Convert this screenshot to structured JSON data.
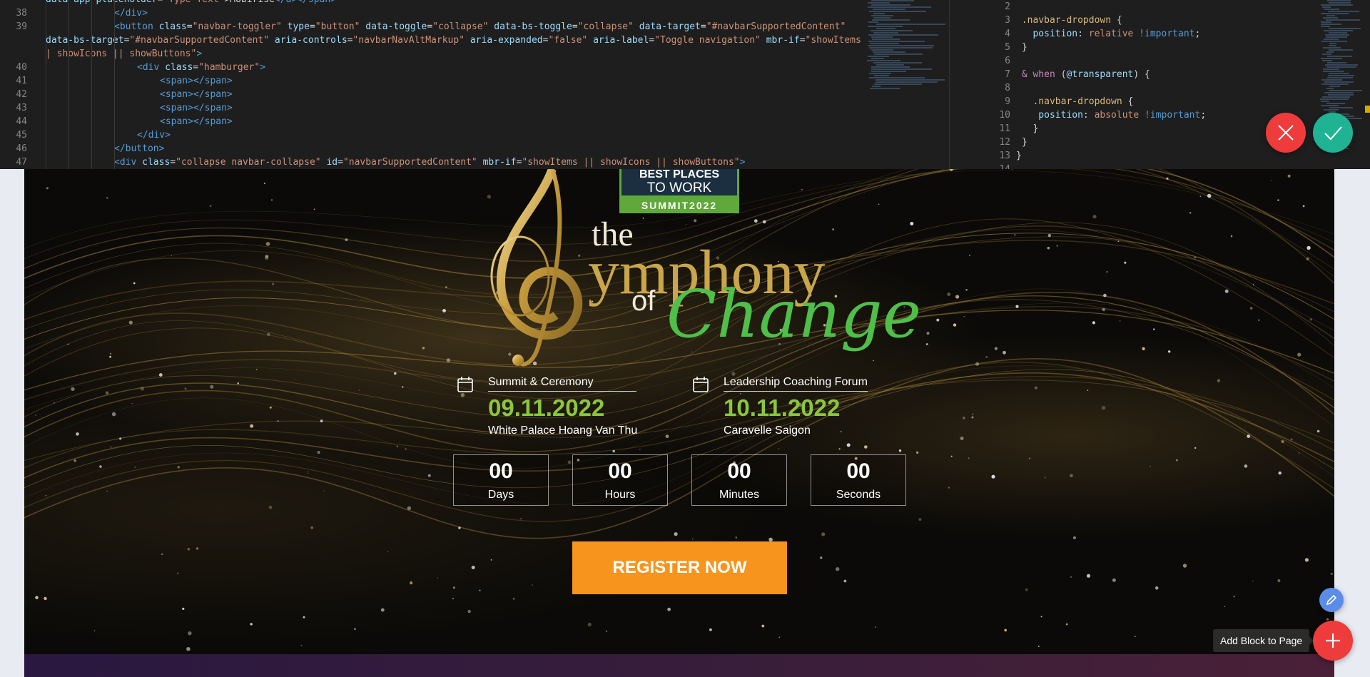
{
  "editor": {
    "html_lines": [
      {
        "no": "",
        "indent": 0,
        "parts": [
          [
            "attr",
            "data-app-placeholder"
          ],
          [
            "txt",
            "="
          ],
          [
            "str",
            "\"Type Text\""
          ],
          [
            "txt",
            ">"
          ],
          [
            "txt",
            "Mobirise"
          ],
          [
            "tag",
            "</a></span>"
          ]
        ]
      },
      {
        "no": "38",
        "indent": 3,
        "parts": [
          [
            "tag",
            "</div>"
          ]
        ]
      },
      {
        "no": "39",
        "indent": 3,
        "parts": [
          [
            "tag",
            "<button "
          ],
          [
            "attr",
            "class"
          ],
          [
            "txt",
            "="
          ],
          [
            "str",
            "\"navbar-toggler\" "
          ],
          [
            "attr",
            "type"
          ],
          [
            "txt",
            "="
          ],
          [
            "str",
            "\"button\" "
          ],
          [
            "attr",
            "data-toggle"
          ],
          [
            "txt",
            "="
          ],
          [
            "str",
            "\"collapse\" "
          ],
          [
            "attr",
            "data-bs-toggle"
          ],
          [
            "txt",
            "="
          ],
          [
            "str",
            "\"collapse\" "
          ],
          [
            "attr",
            "data-target"
          ],
          [
            "txt",
            "="
          ],
          [
            "str",
            "\"#navbarSupportedContent\""
          ]
        ]
      },
      {
        "no": "",
        "indent": 0,
        "parts": [
          [
            "attr",
            "data-bs-target"
          ],
          [
            "txt",
            "="
          ],
          [
            "str",
            "\"#navbarSupportedContent\" "
          ],
          [
            "attr",
            "aria-controls"
          ],
          [
            "txt",
            "="
          ],
          [
            "str",
            "\"navbarNavAltMarkup\" "
          ],
          [
            "attr",
            "aria-expanded"
          ],
          [
            "txt",
            "="
          ],
          [
            "str",
            "\"false\" "
          ],
          [
            "attr",
            "aria-label"
          ],
          [
            "txt",
            "="
          ],
          [
            "str",
            "\"Toggle navigation\" "
          ],
          [
            "attr",
            "mbr-if"
          ],
          [
            "txt",
            "="
          ],
          [
            "str",
            "\"showItems |"
          ]
        ]
      },
      {
        "no": "",
        "indent": 0,
        "parts": [
          [
            "str",
            "| showIcons || showButtons\""
          ],
          [
            "tag",
            ">"
          ]
        ]
      },
      {
        "no": "40",
        "indent": 4,
        "parts": [
          [
            "tag",
            "<div "
          ],
          [
            "attr",
            "class"
          ],
          [
            "txt",
            "="
          ],
          [
            "str",
            "\"hamburger\""
          ],
          [
            "tag",
            ">"
          ]
        ]
      },
      {
        "no": "41",
        "indent": 5,
        "parts": [
          [
            "tag",
            "<span></span>"
          ]
        ]
      },
      {
        "no": "42",
        "indent": 5,
        "parts": [
          [
            "tag",
            "<span></span>"
          ]
        ]
      },
      {
        "no": "43",
        "indent": 5,
        "parts": [
          [
            "tag",
            "<span></span>"
          ]
        ]
      },
      {
        "no": "44",
        "indent": 5,
        "parts": [
          [
            "tag",
            "<span></span>"
          ]
        ]
      },
      {
        "no": "45",
        "indent": 4,
        "parts": [
          [
            "tag",
            "</div>"
          ]
        ]
      },
      {
        "no": "46",
        "indent": 3,
        "parts": [
          [
            "tag",
            "</button>"
          ]
        ]
      },
      {
        "no": "47",
        "indent": 3,
        "parts": [
          [
            "tag",
            "<div "
          ],
          [
            "attr",
            "class"
          ],
          [
            "txt",
            "="
          ],
          [
            "str",
            "\"collapse navbar-collapse\" "
          ],
          [
            "attr",
            "id"
          ],
          [
            "txt",
            "="
          ],
          [
            "str",
            "\"navbarSupportedContent\" "
          ],
          [
            "attr",
            "mbr-if"
          ],
          [
            "txt",
            "="
          ],
          [
            "str",
            "\"showItems || showIcons || showButtons\""
          ],
          [
            "tag",
            ">"
          ]
        ]
      }
    ],
    "css_lines": [
      {
        "no": "2",
        "parts": []
      },
      {
        "no": "3",
        "parts": [
          [
            "sel",
            " .navbar-dropdown "
          ],
          [
            "txt",
            "{"
          ]
        ]
      },
      {
        "no": "4",
        "parts": [
          [
            "prop",
            "   position"
          ],
          [
            "txt",
            ": "
          ],
          [
            "str",
            "relative "
          ],
          [
            "imp",
            "!important"
          ],
          [
            "txt",
            ";"
          ]
        ]
      },
      {
        "no": "5",
        "parts": [
          [
            "txt",
            " }"
          ]
        ]
      },
      {
        "no": "6",
        "parts": []
      },
      {
        "no": "7",
        "parts": [
          [
            "kw",
            " & when "
          ],
          [
            "txt",
            "("
          ],
          [
            "prop",
            "@transparent"
          ],
          [
            "txt",
            ") {"
          ]
        ]
      },
      {
        "no": "8",
        "parts": []
      },
      {
        "no": "9",
        "parts": [
          [
            "sel",
            "   .navbar-dropdown "
          ],
          [
            "txt",
            "{"
          ]
        ]
      },
      {
        "no": "10",
        "parts": [
          [
            "prop",
            "    position"
          ],
          [
            "txt",
            ": "
          ],
          [
            "str",
            "absolute "
          ],
          [
            "imp",
            "!important"
          ],
          [
            "txt",
            ";"
          ]
        ]
      },
      {
        "no": "11",
        "parts": [
          [
            "txt",
            "   }"
          ]
        ]
      },
      {
        "no": "12",
        "parts": [
          [
            "txt",
            " }"
          ]
        ]
      },
      {
        "no": "13",
        "parts": [
          [
            "txt",
            "}"
          ]
        ]
      },
      {
        "no": "14",
        "parts": []
      }
    ]
  },
  "logo": {
    "badge_line1": "BEST PLACES",
    "badge_line2": "TO WORK",
    "badge_bottom": "SUMMIT2022",
    "the": "the",
    "ymphony": "ymphony",
    "of": "of",
    "change": "Change"
  },
  "events": [
    {
      "title": "Summit & Ceremony",
      "date": "09.11.2022",
      "venue": "White Palace Hoang Van Thu"
    },
    {
      "title": "Leadership Coaching Forum",
      "date": "10.11.2022",
      "venue": "Caravelle Saigon"
    }
  ],
  "countdown": {
    "days": {
      "value": "00",
      "label": "Days"
    },
    "hours": {
      "value": "00",
      "label": "Hours"
    },
    "minutes": {
      "value": "00",
      "label": "Minutes"
    },
    "seconds": {
      "value": "00",
      "label": "Seconds"
    }
  },
  "register_label": "REGISTER NOW",
  "chrome": {
    "add_block_tooltip": "Add Block to Page",
    "icons": {
      "cancel": "close-icon",
      "confirm": "check-icon",
      "edit": "pencil-icon",
      "add": "plus-icon",
      "calendar": "calendar-icon"
    }
  },
  "colors": {
    "accent_orange": "#f7941d",
    "date_green": "#8cc63e",
    "cancel_red": "#ee3b3b",
    "confirm_teal": "#1fb394",
    "edit_blue": "#5b8de8"
  }
}
